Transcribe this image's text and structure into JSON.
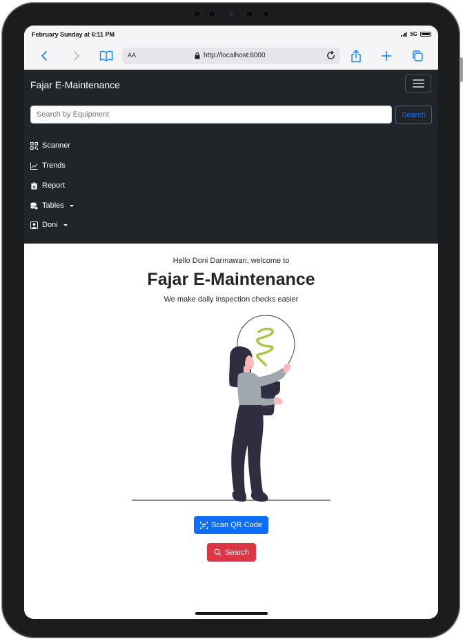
{
  "status_bar": {
    "time": "February Sunday at 6:11 PM",
    "network": "5G"
  },
  "browser": {
    "aa_label": "AA",
    "url": "http://localhost:8000"
  },
  "navbar": {
    "brand": "Fajar E-Maintenance",
    "search_placeholder": "Search by Equipment",
    "search_button": "Search",
    "items": [
      {
        "label": "Scanner",
        "icon": "qr-code-icon"
      },
      {
        "label": "Trends",
        "icon": "graph-icon"
      },
      {
        "label": "Report",
        "icon": "clipboard-icon"
      },
      {
        "label": "Tables",
        "icon": "database-icon",
        "dropdown": true
      },
      {
        "label": "Doni",
        "icon": "person-icon",
        "dropdown": true
      }
    ]
  },
  "main": {
    "greeting": "Hello Doni Darmawan, welcome to",
    "title": "Fajar E-Maintenance",
    "subtitle": "We make daily inspection checks easier",
    "scan_button": "Scan QR Code",
    "search_button": "Search"
  },
  "colors": {
    "navbar_bg": "#212529",
    "primary": "#0d6efd",
    "danger": "#dc3545",
    "bulb_filament": "#a8c64a",
    "figure_dark": "#2f2e41"
  }
}
